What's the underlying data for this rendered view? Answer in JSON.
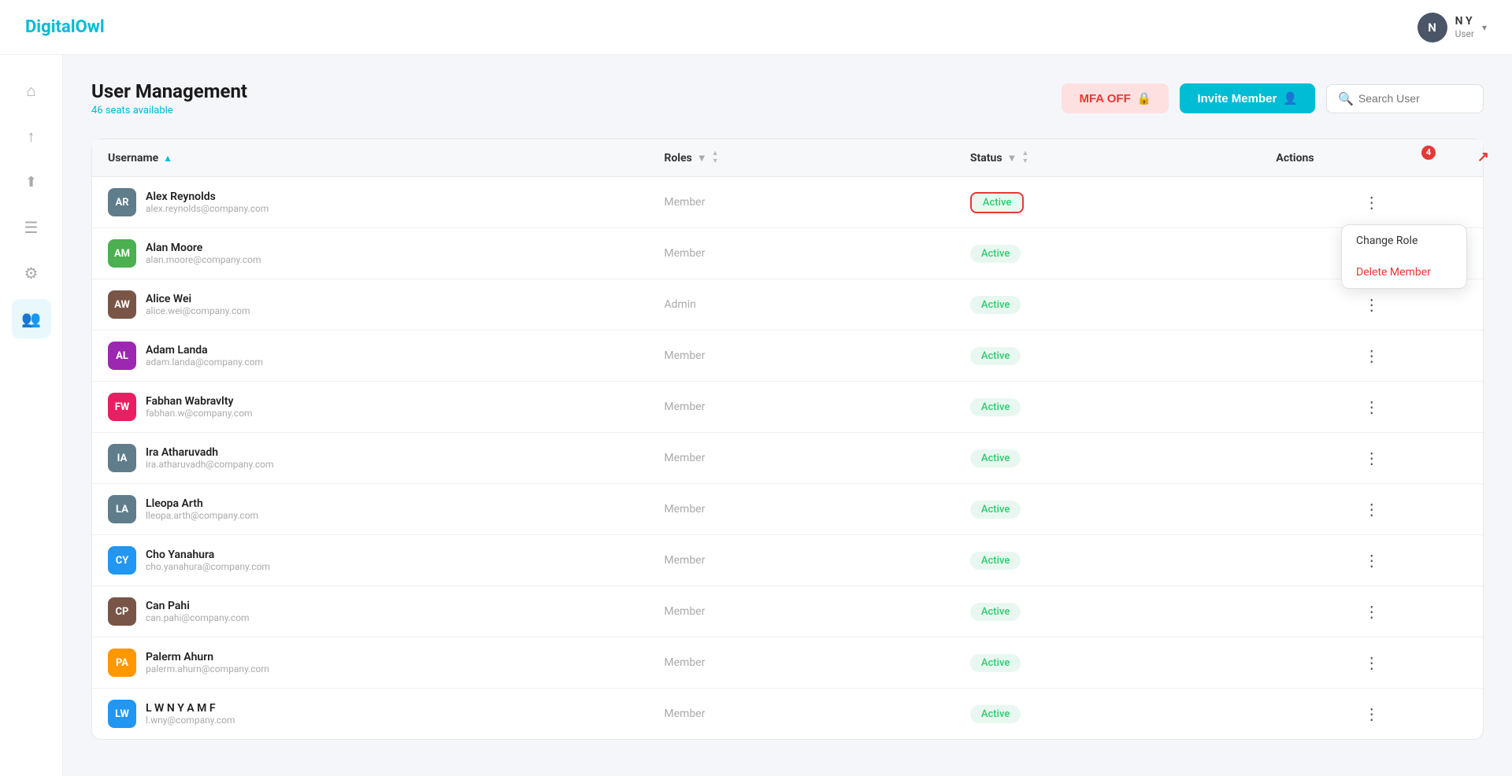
{
  "app": {
    "name_black": "Digital",
    "name_teal": "Owl"
  },
  "header": {
    "user_initial": "N",
    "user_name": "N Y",
    "user_role": "User",
    "chevron": "▾"
  },
  "sidebar": {
    "items": [
      {
        "id": "home",
        "icon": "⌂",
        "active": false
      },
      {
        "id": "upload",
        "icon": "↑",
        "active": false
      },
      {
        "id": "upload2",
        "icon": "⇧",
        "active": false
      },
      {
        "id": "file",
        "icon": "☰",
        "active": false
      },
      {
        "id": "settings",
        "icon": "⚙",
        "active": false
      },
      {
        "id": "users",
        "icon": "👥",
        "active": true
      }
    ]
  },
  "page": {
    "title": "User Management",
    "seats": "46 seats available",
    "mfa_btn": "MFA OFF",
    "invite_btn": "Invite Member",
    "search_placeholder": "Search User"
  },
  "table": {
    "columns": [
      {
        "id": "username",
        "label": "Username",
        "sortable": true,
        "filterable": false
      },
      {
        "id": "roles",
        "label": "Roles",
        "sortable": true,
        "filterable": true
      },
      {
        "id": "status",
        "label": "Status",
        "sortable": true,
        "filterable": true
      },
      {
        "id": "actions",
        "label": "Actions",
        "sortable": false,
        "filterable": false
      }
    ],
    "rows": [
      {
        "id": 1,
        "username": "Alex Reynolds",
        "email": "alex.reynolds@company.com",
        "role": "Member",
        "status": "Active",
        "avatar_color": "#607d8b",
        "avatar_text": "AR",
        "highlighted": true
      },
      {
        "id": 2,
        "username": "Alan Moore",
        "email": "alan.moore@company.com",
        "role": "Member",
        "status": "Active",
        "avatar_color": "#4caf50",
        "avatar_text": "AM",
        "highlighted": false
      },
      {
        "id": 3,
        "username": "Alice Wei",
        "email": "alice.wei@company.com",
        "role": "Admin",
        "status": "Active",
        "avatar_color": "#795548",
        "avatar_text": "AW",
        "highlighted": false
      },
      {
        "id": 4,
        "username": "Adam Landa",
        "email": "adam.landa@company.com",
        "role": "Member",
        "status": "Active",
        "avatar_color": "#9c27b0",
        "avatar_text": "AL",
        "highlighted": false
      },
      {
        "id": 5,
        "username": "Fabhan Wabravlty",
        "email": "fabhan.w@company.com",
        "role": "Member",
        "status": "Active",
        "avatar_color": "#e91e63",
        "avatar_text": "FW",
        "highlighted": false
      },
      {
        "id": 6,
        "username": "Ira Atharuvadh",
        "email": "ira.atharuvadh@company.com",
        "role": "Member",
        "status": "Active",
        "avatar_color": "#607d8b",
        "avatar_text": "IA",
        "highlighted": false
      },
      {
        "id": 7,
        "username": "Lleopa Arth",
        "email": "lleopa.arth@company.com",
        "role": "Member",
        "status": "Active",
        "avatar_color": "#607d8b",
        "avatar_text": "LA",
        "highlighted": false
      },
      {
        "id": 8,
        "username": "Cho Yanahura",
        "email": "cho.yanahura@company.com",
        "role": "Member",
        "status": "Active",
        "avatar_color": "#2196f3",
        "avatar_text": "CY",
        "highlighted": false
      },
      {
        "id": 9,
        "username": "Can Pahi",
        "email": "can.pahi@company.com",
        "role": "Member",
        "status": "Active",
        "avatar_color": "#795548",
        "avatar_text": "CP",
        "highlighted": false
      },
      {
        "id": 10,
        "username": "Palerm Ahurn",
        "email": "palerm.ahurn@company.com",
        "role": "Member",
        "status": "Active",
        "avatar_color": "#ff9800",
        "avatar_text": "PA",
        "highlighted": false
      },
      {
        "id": 11,
        "username": "L W N Y A M F",
        "email": "l.wny@company.com",
        "role": "Member",
        "status": "Active",
        "avatar_color": "#2196f3",
        "avatar_text": "LW",
        "highlighted": false
      }
    ]
  },
  "dropdown": {
    "change_role": "Change Role",
    "delete_member": "Delete Member"
  },
  "annotation": {
    "badge_number": "4"
  }
}
